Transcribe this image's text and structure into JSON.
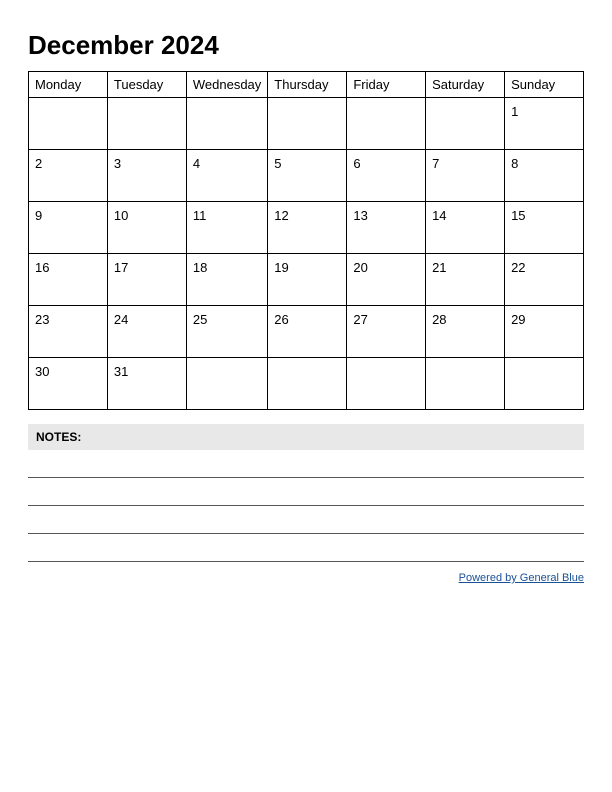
{
  "title": "December 2024",
  "calendar": {
    "headers": [
      "Monday",
      "Tuesday",
      "Wednesday",
      "Thursday",
      "Friday",
      "Saturday",
      "Sunday"
    ],
    "weeks": [
      [
        null,
        null,
        null,
        null,
        null,
        null,
        1
      ],
      [
        2,
        3,
        4,
        5,
        6,
        7,
        8
      ],
      [
        9,
        10,
        11,
        12,
        13,
        14,
        15
      ],
      [
        16,
        17,
        18,
        19,
        20,
        21,
        22
      ],
      [
        23,
        24,
        25,
        26,
        27,
        28,
        29
      ],
      [
        30,
        31,
        null,
        null,
        null,
        null,
        null
      ]
    ]
  },
  "notes": {
    "label": "NOTES:",
    "lines": 4
  },
  "footer": {
    "text": "Powered by General Blue",
    "url": "#"
  }
}
